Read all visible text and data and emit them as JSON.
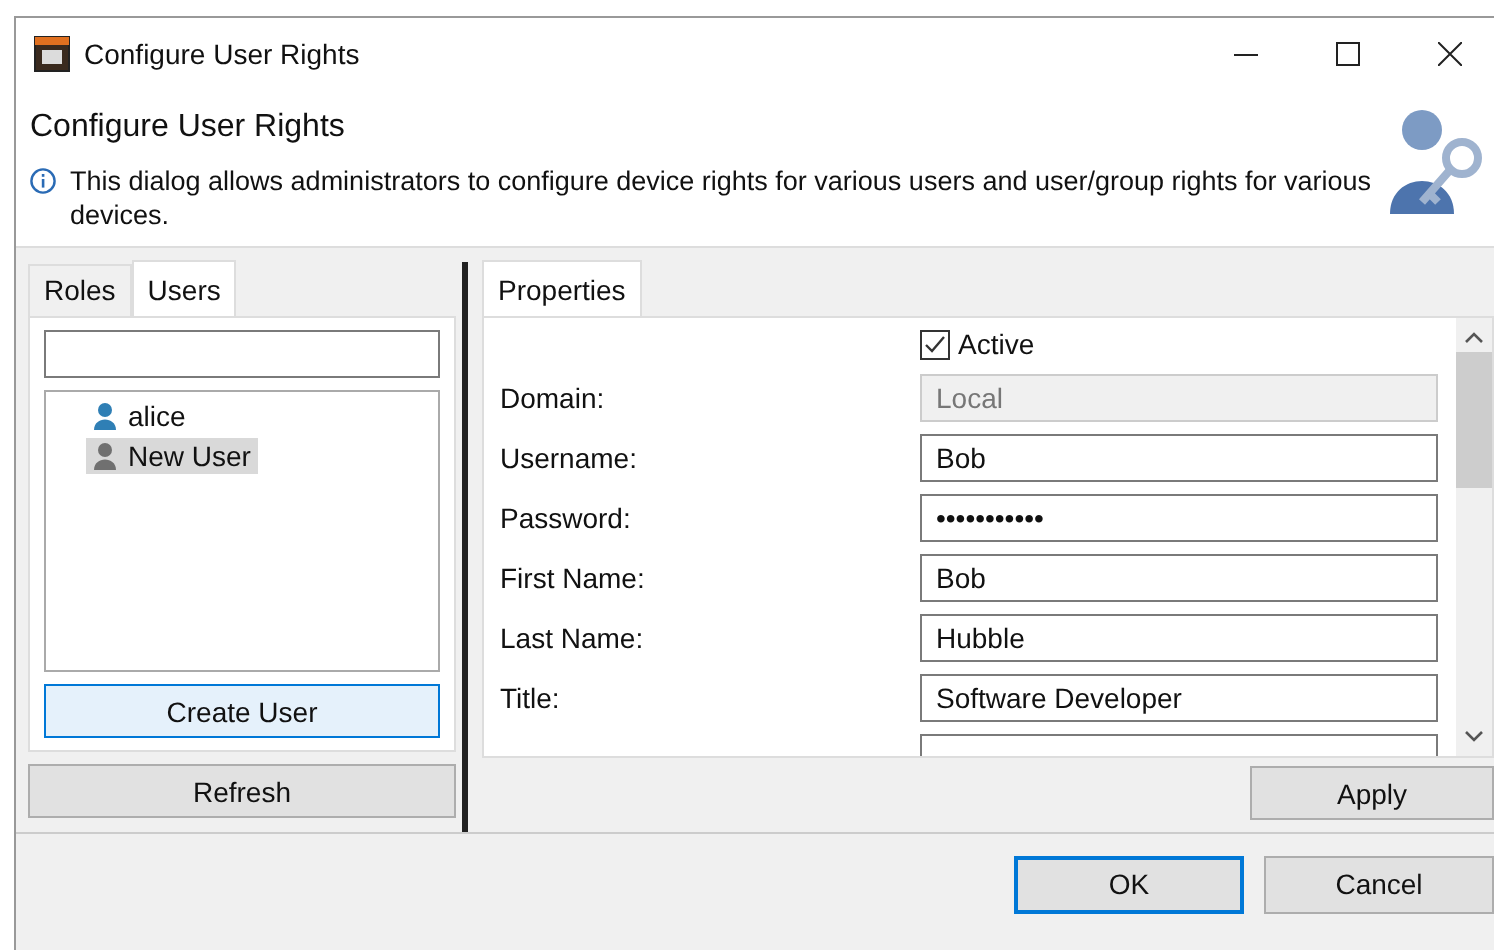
{
  "window": {
    "title": "Configure User Rights"
  },
  "header": {
    "title": "Configure User Rights",
    "description": "This dialog allows administrators to configure device rights for various users and user/group rights for various devices."
  },
  "left_tabs": [
    {
      "label": "Roles",
      "selected": false
    },
    {
      "label": "Users",
      "selected": true
    }
  ],
  "users": [
    {
      "name": "alice",
      "selected": false,
      "color": "#2f7fb5"
    },
    {
      "name": "New User",
      "selected": true,
      "color": "#707070"
    }
  ],
  "create_button": "Create User",
  "refresh_button": "Refresh",
  "right_tabs": [
    {
      "label": "Properties",
      "selected": true
    }
  ],
  "active": {
    "label": "Active",
    "checked": true
  },
  "fields": [
    {
      "label": "Domain:",
      "value": "Local",
      "disabled": true
    },
    {
      "label": "Username:",
      "value": "Bob",
      "disabled": false
    },
    {
      "label": "Password:",
      "value": "•••••••••••",
      "disabled": false
    },
    {
      "label": "First Name:",
      "value": "Bob",
      "disabled": false
    },
    {
      "label": "Last Name:",
      "value": "Hubble",
      "disabled": false
    },
    {
      "label": "Title:",
      "value": "Software Developer",
      "disabled": false
    }
  ],
  "apply_button": "Apply",
  "buttons": [
    {
      "label": "OK",
      "default": true
    },
    {
      "label": "Cancel",
      "default": false
    }
  ]
}
